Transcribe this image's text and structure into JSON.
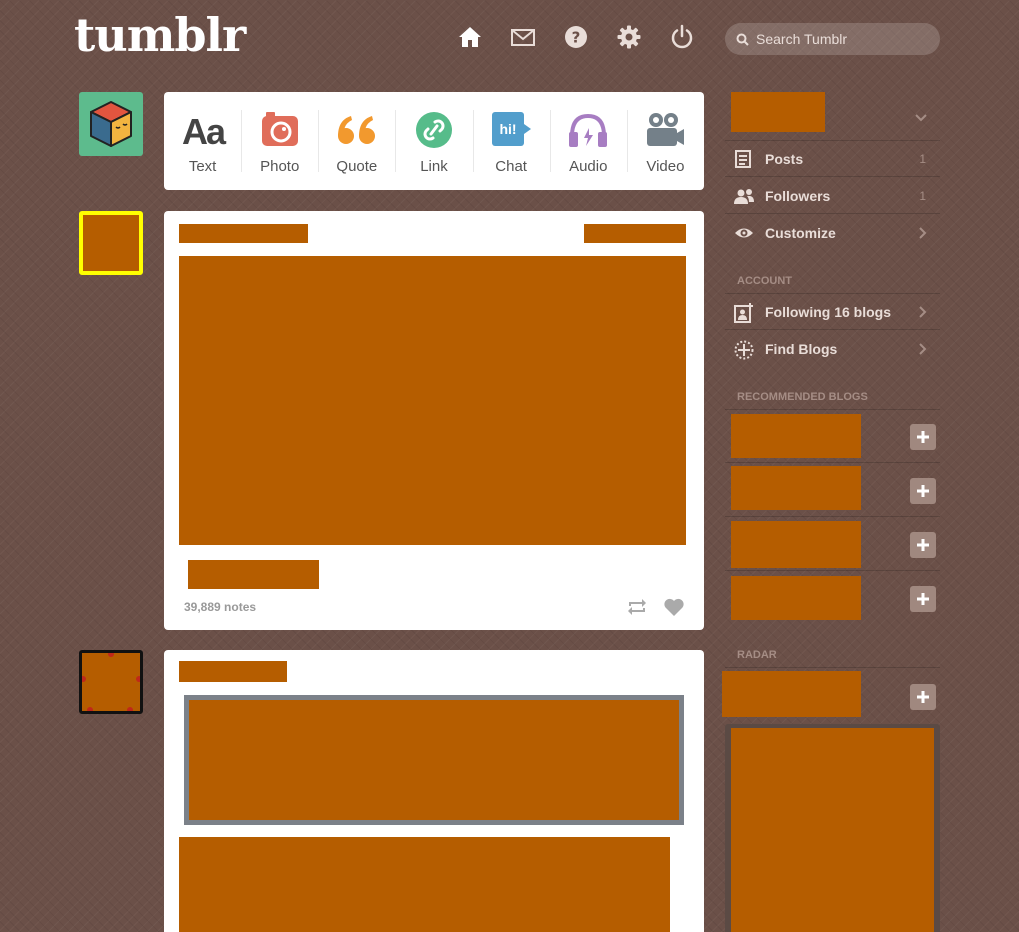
{
  "header": {
    "logo": "tumblr",
    "search_placeholder": "Search Tumblr"
  },
  "compose": [
    {
      "label": "Text",
      "icon": "text-icon"
    },
    {
      "label": "Photo",
      "icon": "camera-icon"
    },
    {
      "label": "Quote",
      "icon": "quote-icon"
    },
    {
      "label": "Link",
      "icon": "link-icon"
    },
    {
      "label": "Chat",
      "icon": "chat-icon"
    },
    {
      "label": "Audio",
      "icon": "headphones-icon"
    },
    {
      "label": "Video",
      "icon": "video-camera-icon"
    }
  ],
  "compose_colors": {
    "text": "#444444",
    "photo": "#e06d5a",
    "quote": "#f2992e",
    "link": "#56bc8a",
    "chat": "#529ecc",
    "audio": "#a77dc2",
    "video": "#748089"
  },
  "posts": [
    {
      "notes": "39,889 notes"
    }
  ],
  "sidebar": {
    "items": [
      {
        "label": "Posts",
        "count": "1"
      },
      {
        "label": "Followers",
        "count": "1"
      },
      {
        "label": "Customize"
      }
    ],
    "account_heading": "ACCOUNT",
    "account_items": [
      {
        "label": "Following 16 blogs"
      },
      {
        "label": "Find Blogs"
      }
    ],
    "recommended_heading": "RECOMMENDED BLOGS",
    "radar_heading": "RADAR"
  },
  "colors": {
    "background": "#6b5048",
    "redaction": "#b55d00",
    "sidebar_text": "#e9ddd8"
  }
}
